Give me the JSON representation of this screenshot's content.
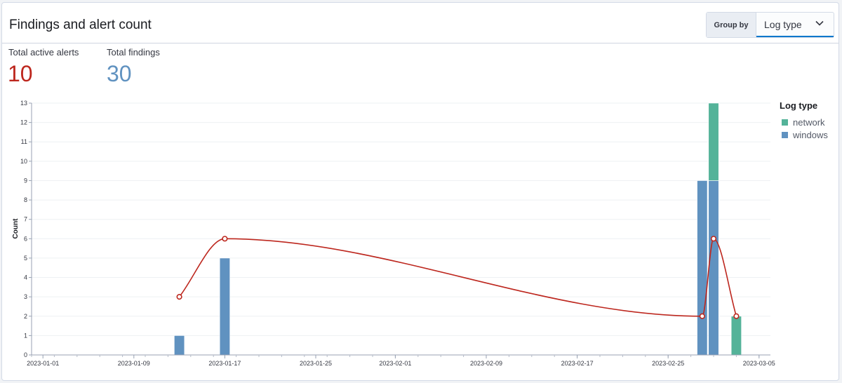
{
  "panel": {
    "title": "Findings and alert count"
  },
  "group_by": {
    "label": "Group by",
    "value": "Log type"
  },
  "stats": {
    "alerts": {
      "label": "Total active alerts",
      "value": "10",
      "color": "#bd271e"
    },
    "findings": {
      "label": "Total findings",
      "value": "30",
      "color": "#6092c0"
    }
  },
  "colors": {
    "network": "#54b399",
    "windows": "#6092c0",
    "alerts_line": "#bd271e"
  },
  "chart_data": {
    "type": "bar",
    "ylabel": "Count",
    "xlabel": "",
    "ylim": [
      0,
      13
    ],
    "yticks": [
      0,
      1,
      2,
      3,
      4,
      5,
      6,
      7,
      8,
      9,
      10,
      11,
      12,
      13
    ],
    "xlim": [
      "2022-12-31",
      "2023-03-06"
    ],
    "xticks": [
      "2023-01-01",
      "2023-01-09",
      "2023-01-17",
      "2023-01-25",
      "2023-02-01",
      "2023-02-09",
      "2023-02-17",
      "2023-02-25",
      "2023-03-05"
    ],
    "legend": {
      "title": "Log type",
      "position": "right"
    },
    "grid": true,
    "bar_series": [
      {
        "name": "network",
        "points": [
          {
            "x": "2023-03-01",
            "y": 4
          },
          {
            "x": "2023-03-03",
            "y": 2
          }
        ]
      },
      {
        "name": "windows",
        "points": [
          {
            "x": "2023-01-13",
            "y": 1
          },
          {
            "x": "2023-01-17",
            "y": 5
          },
          {
            "x": "2023-02-28",
            "y": 9
          },
          {
            "x": "2023-03-01",
            "y": 9
          }
        ]
      }
    ],
    "line_series": {
      "points": [
        {
          "x": "2023-01-13",
          "y": 3
        },
        {
          "x": "2023-01-17",
          "y": 6
        },
        {
          "x": "2023-02-28",
          "y": 2
        },
        {
          "x": "2023-03-01",
          "y": 6
        },
        {
          "x": "2023-03-03",
          "y": 2
        }
      ]
    }
  }
}
